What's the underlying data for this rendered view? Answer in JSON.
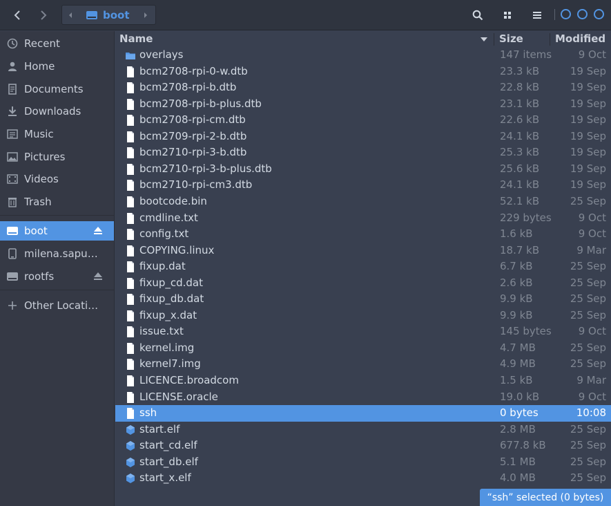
{
  "toolbar": {
    "back_icon": "chevron-left",
    "forward_icon": "chevron-right",
    "path": "boot",
    "search_icon": "search",
    "view_icon": "grid",
    "menu_icon": "hamburger"
  },
  "colors": {
    "accent": "#5294e2",
    "background": "#394050",
    "sidebar": "#353945",
    "headerbar": "#2f343f"
  },
  "sidebar": {
    "places": [
      {
        "label": "Recent",
        "icon": "clock-icon"
      },
      {
        "label": "Home",
        "icon": "home-icon"
      },
      {
        "label": "Documents",
        "icon": "document-icon"
      },
      {
        "label": "Downloads",
        "icon": "download-icon"
      },
      {
        "label": "Music",
        "icon": "music-icon"
      },
      {
        "label": "Pictures",
        "icon": "picture-icon"
      },
      {
        "label": "Videos",
        "icon": "video-icon"
      },
      {
        "label": "Trash",
        "icon": "trash-icon"
      }
    ],
    "devices": [
      {
        "label": "boot",
        "icon": "drive-icon",
        "active": true,
        "ejectable": true
      },
      {
        "label": "milena.sapunova...",
        "icon": "phone-icon",
        "active": false,
        "ejectable": false
      },
      {
        "label": "rootfs",
        "icon": "drive-icon",
        "active": false,
        "ejectable": true
      }
    ],
    "other_locations": {
      "label": "Other Locations",
      "icon": "plus-icon"
    }
  },
  "columns": {
    "name": "Name",
    "size": "Size",
    "modified": "Modified"
  },
  "files": [
    {
      "name": "overlays",
      "size": "147 items",
      "modified": "9 Oct",
      "type": "folder"
    },
    {
      "name": "bcm2708-rpi-0-w.dtb",
      "size": "23.3 kB",
      "modified": "19 Sep",
      "type": "file"
    },
    {
      "name": "bcm2708-rpi-b.dtb",
      "size": "22.8 kB",
      "modified": "19 Sep",
      "type": "file"
    },
    {
      "name": "bcm2708-rpi-b-plus.dtb",
      "size": "23.1 kB",
      "modified": "19 Sep",
      "type": "file"
    },
    {
      "name": "bcm2708-rpi-cm.dtb",
      "size": "22.6 kB",
      "modified": "19 Sep",
      "type": "file"
    },
    {
      "name": "bcm2709-rpi-2-b.dtb",
      "size": "24.1 kB",
      "modified": "19 Sep",
      "type": "file"
    },
    {
      "name": "bcm2710-rpi-3-b.dtb",
      "size": "25.3 kB",
      "modified": "19 Sep",
      "type": "file"
    },
    {
      "name": "bcm2710-rpi-3-b-plus.dtb",
      "size": "25.6 kB",
      "modified": "19 Sep",
      "type": "file"
    },
    {
      "name": "bcm2710-rpi-cm3.dtb",
      "size": "24.1 kB",
      "modified": "19 Sep",
      "type": "file"
    },
    {
      "name": "bootcode.bin",
      "size": "52.1 kB",
      "modified": "25 Sep",
      "type": "file"
    },
    {
      "name": "cmdline.txt",
      "size": "229 bytes",
      "modified": "9 Oct",
      "type": "file"
    },
    {
      "name": "config.txt",
      "size": "1.6 kB",
      "modified": "9 Oct",
      "type": "file"
    },
    {
      "name": "COPYING.linux",
      "size": "18.7 kB",
      "modified": "9 Mar",
      "type": "file"
    },
    {
      "name": "fixup.dat",
      "size": "6.7 kB",
      "modified": "25 Sep",
      "type": "file"
    },
    {
      "name": "fixup_cd.dat",
      "size": "2.6 kB",
      "modified": "25 Sep",
      "type": "file"
    },
    {
      "name": "fixup_db.dat",
      "size": "9.9 kB",
      "modified": "25 Sep",
      "type": "file"
    },
    {
      "name": "fixup_x.dat",
      "size": "9.9 kB",
      "modified": "25 Sep",
      "type": "file"
    },
    {
      "name": "issue.txt",
      "size": "145 bytes",
      "modified": "9 Oct",
      "type": "file"
    },
    {
      "name": "kernel.img",
      "size": "4.7 MB",
      "modified": "25 Sep",
      "type": "file"
    },
    {
      "name": "kernel7.img",
      "size": "4.9 MB",
      "modified": "25 Sep",
      "type": "file"
    },
    {
      "name": "LICENCE.broadcom",
      "size": "1.5 kB",
      "modified": "9 Mar",
      "type": "file"
    },
    {
      "name": "LICENSE.oracle",
      "size": "19.0 kB",
      "modified": "9 Oct",
      "type": "file"
    },
    {
      "name": "ssh",
      "size": "0 bytes",
      "modified": "10:08",
      "type": "file",
      "selected": true
    },
    {
      "name": "start.elf",
      "size": "2.8 MB",
      "modified": "25 Sep",
      "type": "binary"
    },
    {
      "name": "start_cd.elf",
      "size": "677.8 kB",
      "modified": "25 Sep",
      "type": "binary"
    },
    {
      "name": "start_db.elf",
      "size": "5.1 MB",
      "modified": "25 Sep",
      "type": "binary"
    },
    {
      "name": "start_x.elf",
      "size": "4.0 MB",
      "modified": "25 Sep",
      "type": "binary"
    }
  ],
  "status": "“ssh” selected  (0 bytes)"
}
